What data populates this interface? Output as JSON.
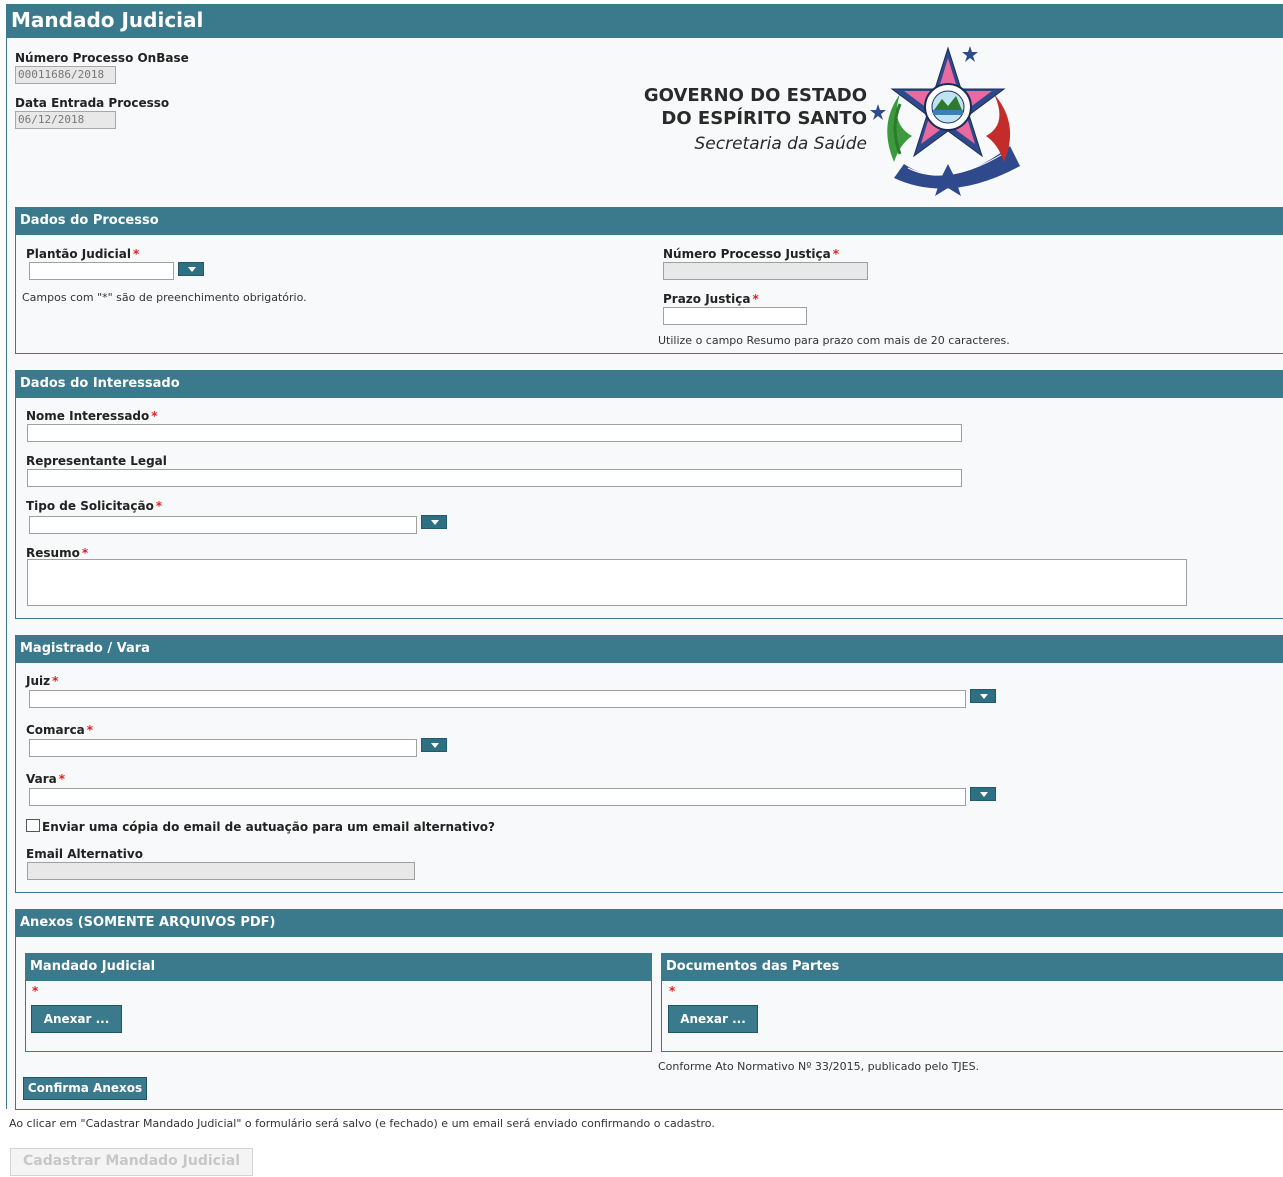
{
  "page": {
    "title": "Mandado Judicial"
  },
  "header": {
    "numero_processo_label": "Número Processo OnBase",
    "numero_processo_value": "00011686/2018",
    "data_entrada_label": "Data Entrada Processo",
    "data_entrada_value": "06/12/2018",
    "logo_line1": "GOVERNO DO ESTADO",
    "logo_line2": "DO ESPÍRITO SANTO",
    "logo_line3": "Secretaria da Saúde"
  },
  "dados_processo": {
    "title": "Dados do Processo",
    "plantao_label": "Plantão Judicial",
    "plantao_value": "",
    "campos_note": "Campos com \"*\" são de preenchimento obrigatório.",
    "numero_justica_label": "Número Processo Justiça",
    "numero_justica_value": "",
    "prazo_label": "Prazo Justiça",
    "prazo_value": "",
    "prazo_note": "Utilize o campo Resumo para prazo com mais de 20 caracteres."
  },
  "dados_interessado": {
    "title": "Dados do Interessado",
    "nome_label": "Nome Interessado",
    "nome_value": "",
    "representante_label": "Representante Legal",
    "representante_value": "",
    "tipo_label": "Tipo de Solicitação",
    "tipo_value": "",
    "resumo_label": "Resumo",
    "resumo_value": ""
  },
  "magistrado": {
    "title": "Magistrado / Vara",
    "juiz_label": "Juiz",
    "juiz_value": "",
    "comarca_label": "Comarca",
    "comarca_value": "",
    "vara_label": "Vara",
    "vara_value": "",
    "copia_email_label": "Enviar uma cópia do email de autuação para um email alternativo?",
    "copia_email_checked": false,
    "email_alt_label": "Email Alternativo",
    "email_alt_value": ""
  },
  "anexos": {
    "title": "Anexos (SOMENTE ARQUIVOS PDF)",
    "mandado_title": "Mandado Judicial",
    "documentos_title": "Documentos das Partes",
    "required_mark": "*",
    "anexar_label": "Anexar ...",
    "conforme_note": "Conforme Ato Normativo Nº 33/2015, publicado pelo TJES.",
    "confirma_label": "Confirma Anexos"
  },
  "footer": {
    "note": "Ao clicar em \"Cadastrar Mandado Judicial\" o formulário será salvo (e fechado) e um email será enviado confirmando o cadastro.",
    "submit_label": "Cadastrar Mandado Judicial"
  },
  "required_symbol": "*",
  "colors": {
    "header": "#3b7a8c",
    "button": "#2f6f82",
    "required": "#e02020"
  }
}
